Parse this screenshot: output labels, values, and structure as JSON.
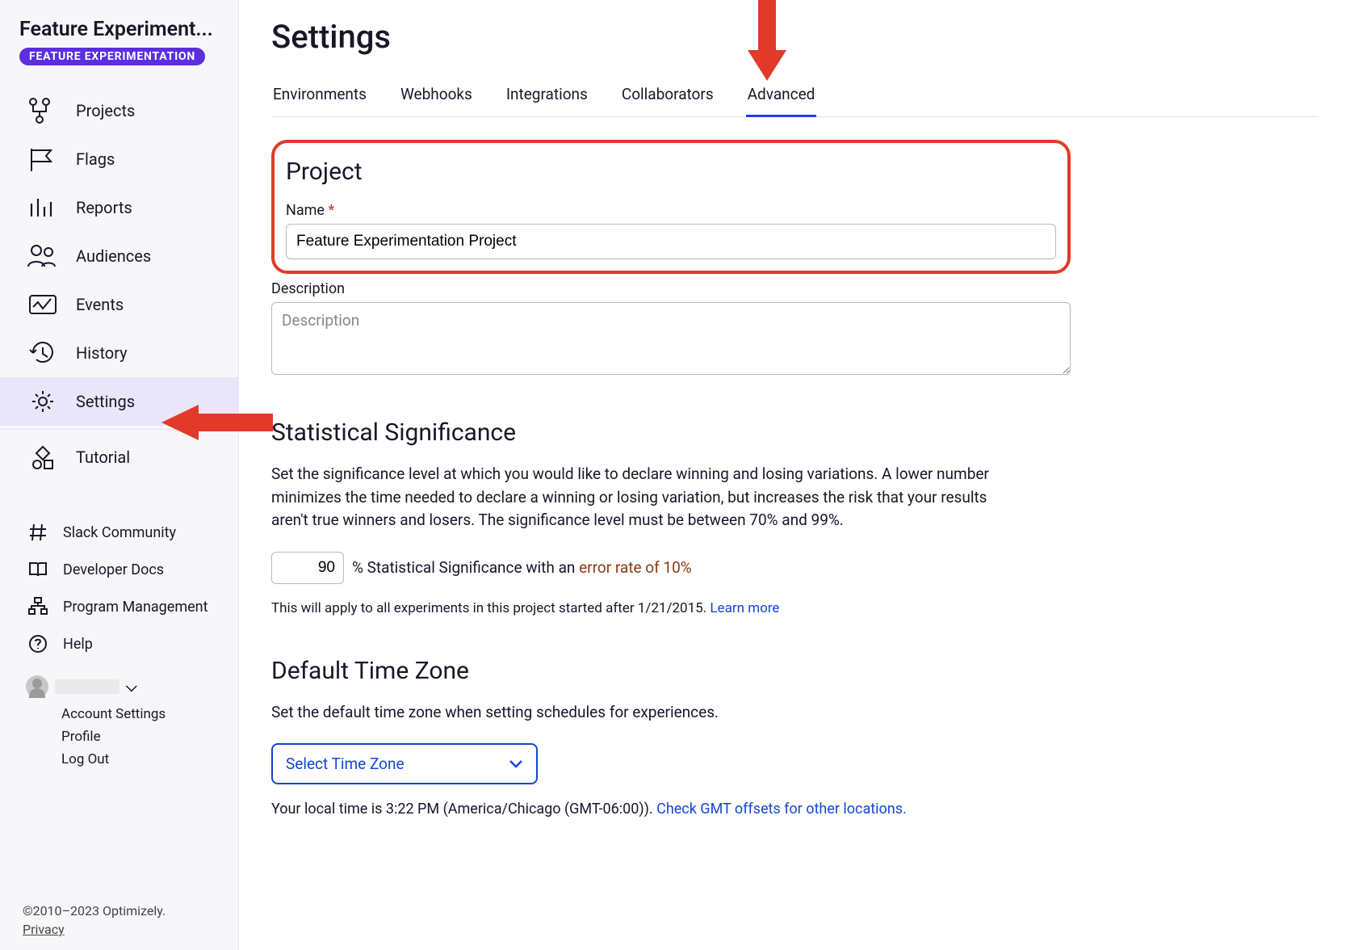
{
  "sidebar": {
    "project_title": "Feature Experiment...",
    "badge": "FEATURE EXPERIMENTATION",
    "nav": [
      {
        "label": "Projects",
        "icon": "projects"
      },
      {
        "label": "Flags",
        "icon": "flags"
      },
      {
        "label": "Reports",
        "icon": "reports"
      },
      {
        "label": "Audiences",
        "icon": "audiences"
      },
      {
        "label": "Events",
        "icon": "events"
      },
      {
        "label": "History",
        "icon": "history"
      },
      {
        "label": "Settings",
        "icon": "settings"
      },
      {
        "label": "Tutorial",
        "icon": "tutorial"
      }
    ],
    "secondary": [
      {
        "label": "Slack Community",
        "icon": "hash"
      },
      {
        "label": "Developer Docs",
        "icon": "book"
      },
      {
        "label": "Program Management",
        "icon": "org"
      },
      {
        "label": "Help",
        "icon": "help"
      }
    ],
    "account_menu": [
      "Account Settings",
      "Profile",
      "Log Out"
    ],
    "copyright": "©2010–2023 Optimizely.",
    "privacy": "Privacy"
  },
  "page": {
    "title": "Settings",
    "tabs": [
      "Environments",
      "Webhooks",
      "Integrations",
      "Collaborators",
      "Advanced"
    ],
    "active_tab": "Advanced",
    "project": {
      "heading": "Project",
      "name_label": "Name",
      "name_value": "Feature Experimentation Project",
      "desc_label": "Description",
      "desc_placeholder": "Description"
    },
    "sig": {
      "heading": "Statistical Significance",
      "body": "Set the significance level at which you would like to declare winning and losing variations. A lower number minimizes the time needed to declare a winning or losing variation, but increases the risk that your results aren't true winners and losers. The significance level must be between 70% and 99%.",
      "value": "90",
      "suffix_text": "%  Statistical Significance with an ",
      "error_link": "error rate of 10%",
      "helper": "This will apply to all experiments in this project started after 1/21/2015. ",
      "learn_more": "Learn more"
    },
    "tz": {
      "heading": "Default Time Zone",
      "body": "Set the default time zone when setting schedules for experiences.",
      "placeholder": "Select Time Zone",
      "help_prefix": "Your local time is 3:22 PM (America/Chicago (GMT-06:00)). ",
      "help_link": "Check GMT offsets for other locations."
    }
  }
}
